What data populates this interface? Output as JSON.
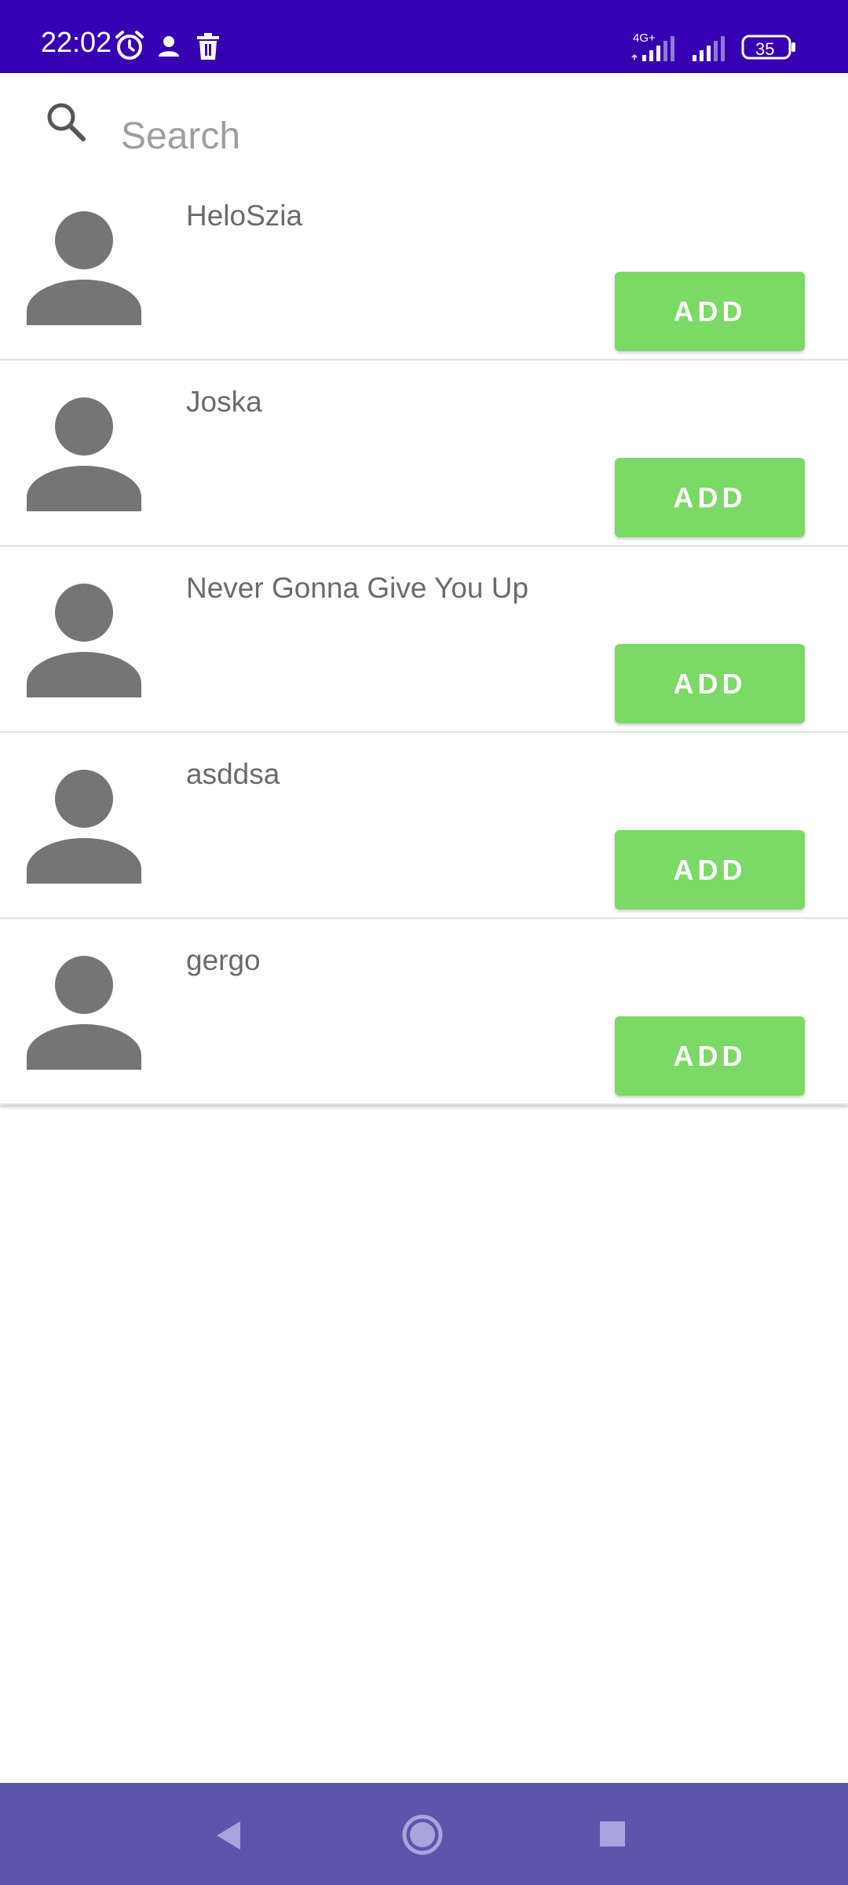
{
  "status_bar": {
    "time": "22:02",
    "network_label": "4G+",
    "battery_level": "35",
    "background_color": "#3700b3",
    "icons": [
      "alarm-icon",
      "person-icon",
      "trash-icon",
      "signal-icon",
      "signal-icon",
      "battery-icon"
    ]
  },
  "search": {
    "placeholder": "Search",
    "value": "",
    "icon": "search-icon"
  },
  "users": [
    {
      "name": "HeloSzia",
      "button_label": "ADD"
    },
    {
      "name": "Joska",
      "button_label": "ADD"
    },
    {
      "name": "Never Gonna Give You Up",
      "button_label": "ADD"
    },
    {
      "name": "asddsa",
      "button_label": "ADD"
    },
    {
      "name": "gergo",
      "button_label": "ADD"
    }
  ],
  "colors": {
    "accent_green": "#7bd966",
    "avatar_gray": "#757575",
    "nav_bar": "#5b55ab"
  },
  "nav_bar": {
    "icons": [
      "back-icon",
      "home-icon",
      "recents-icon"
    ]
  }
}
